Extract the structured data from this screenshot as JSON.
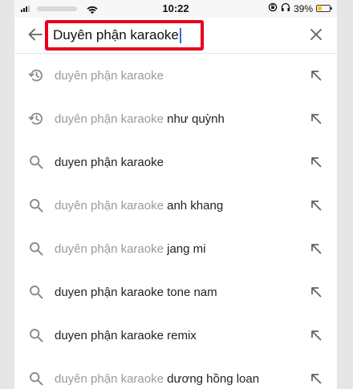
{
  "status_bar": {
    "time": "10:22",
    "battery_percent": "39%",
    "battery_level": 0.39,
    "icons": [
      "signal-icon",
      "wifi-icon",
      "orientation-lock-icon",
      "headphones-icon",
      "battery-icon"
    ]
  },
  "search": {
    "query": "Duyên phận karaoke",
    "back_icon": "arrow-left-icon",
    "clear_icon": "close-icon",
    "highlight_color": "#e8001c"
  },
  "suggestions": [
    {
      "icon": "history-icon",
      "prefix": "duyên phận karaoke",
      "rest": "",
      "prefix_style": "muted"
    },
    {
      "icon": "history-icon",
      "prefix": "duyên phận karaoke",
      "rest": " như quỳnh",
      "prefix_style": "muted"
    },
    {
      "icon": "search-icon",
      "prefix": "duyen phận karaoke",
      "rest": "",
      "prefix_style": "dark"
    },
    {
      "icon": "search-icon",
      "prefix": "duyên phận karaoke",
      "rest": " anh khang",
      "prefix_style": "muted"
    },
    {
      "icon": "search-icon",
      "prefix": "duyên phận karaoke",
      "rest": " jang mi",
      "prefix_style": "muted"
    },
    {
      "icon": "search-icon",
      "prefix": "duyen phận karaoke tone nam",
      "rest": "",
      "prefix_style": "dark"
    },
    {
      "icon": "search-icon",
      "prefix": "duyen phận karaoke remix",
      "rest": "",
      "prefix_style": "dark"
    },
    {
      "icon": "search-icon",
      "prefix": "duyên phận karaoke",
      "rest": " dương hồng loan",
      "prefix_style": "muted"
    }
  ]
}
